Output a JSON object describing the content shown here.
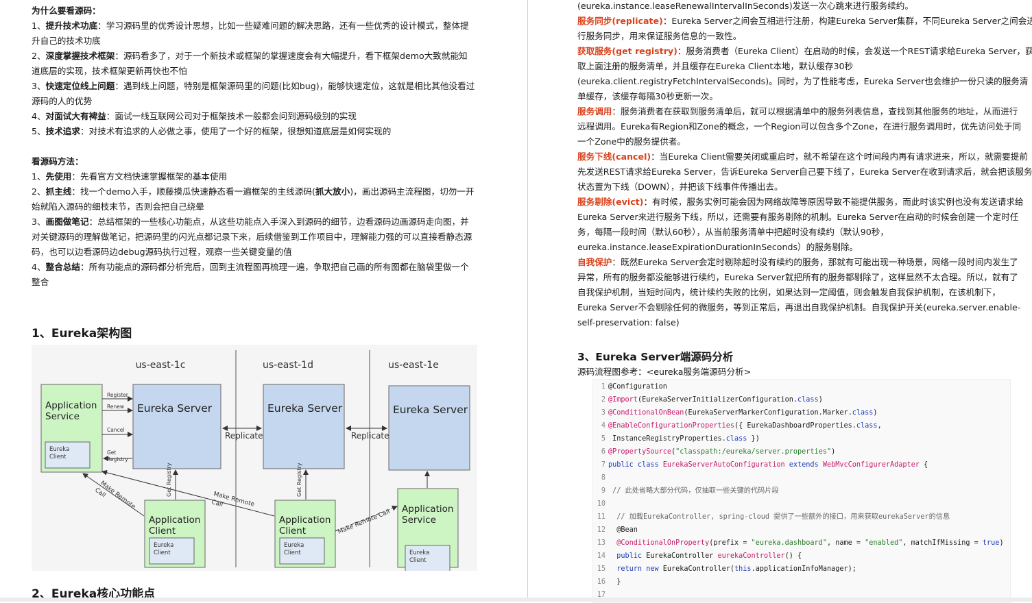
{
  "left": {
    "why_title": "为什么要看源码：",
    "why_items": [
      {
        "num": "1、",
        "key": "提升技术功底",
        "sep": "：",
        "text_line1": "学习源码里的优秀设计思想，比如一些疑难问题的解决思路，还有一些优秀的设计模式，整体提",
        "text_line2": "升自己的技术功底"
      },
      {
        "num": "2、",
        "key": "深度掌握技术框架",
        "sep": "：",
        "text_line1": "源码看多了，对于一个新技术或框架的掌握速度会有大幅提升，看下框架demo大致就能知",
        "text_line2": "道底层的实现，技术框架更新再快也不怕"
      },
      {
        "num": "3、",
        "key": "快速定位线上问题",
        "sep": "：",
        "text_line1": "遇到线上问题，特别是框架源码里的问题(比如bug)，能够快速定位，这就是相比其他没看过",
        "text_line2": "源码的人的优势"
      },
      {
        "num": "4、",
        "key": "对面试大有裨益",
        "sep": "：",
        "text_line1": "面试一线互联网公司对于框架技术一般都会问到源码级别的实现",
        "text_line2": ""
      },
      {
        "num": "5、",
        "key": "技术追求",
        "sep": "：",
        "text_line1": "对技术有追求的人必做之事，使用了一个好的框架，很想知道底层是如何实现的",
        "text_line2": ""
      }
    ],
    "method_title": "看源码方法：",
    "method_items": {
      "m1": {
        "num": "1、",
        "key": "先使用",
        "text": "：先看官方文档快速掌握框架的基本使用"
      },
      "m2": {
        "num": "2、",
        "key": "抓主线",
        "text_a": "：找一个demo入手，顺藤摸瓜快速静态看一遍框架的主线源码(",
        "bold_b": "抓大放小",
        "text_c": ")，画出源码主流程图，切勿一开",
        "line2": "始就陷入源码的细枝末节，否则会把自己绕晕"
      },
      "m3": {
        "num": "3、",
        "key": "画图做笔记",
        "text": "：总结框架的一些核心功能点，从这些功能点入手深入到源码的细节，边看源码边画源码走向图，并",
        "line2": "对关键源码的理解做笔记，把源码里的闪光点都记录下来，后续借鉴到工作项目中，理解能力强的可以直接看静态源",
        "line3": "码，也可以边看源码边debug源码执行过程，观察一些关键变量的值"
      },
      "m4": {
        "num": "4、",
        "key": "整合总结",
        "text": "：所有功能点的源码都分析完后，回到主流程图再梳理一遍，争取把自己画的所有图都在脑袋里做一个",
        "line2": "整合"
      }
    },
    "section1_title": "1、Eureka架构图",
    "section2_title": "2、Eureka核心功能点",
    "diagram": {
      "regions": [
        "us-east-1c",
        "us-east-1d",
        "us-east-1e"
      ],
      "server_label": "Eureka Server",
      "app_service_l1": "Application",
      "app_service_l2": "Service",
      "app_client_l1": "Application",
      "app_client_l2": "Client",
      "eureka_client_l1": "Eureka",
      "eureka_client_l2": "Client",
      "register": "Register",
      "renew": "Renew",
      "cancel": "Cancel",
      "get": "Get",
      "registry": "Registry",
      "replicate": "Replicate",
      "get_registry": "Get Registry",
      "make_remote_call": "Make Remote Call",
      "make_remote": "Make Remote",
      "call": "Call"
    }
  },
  "right": {
    "top_line": "(eureka.instance.leaseRenewalIntervalInSeconds)发送一次心跳来进行服务续约。",
    "sync": {
      "key": "服务同步(replicate)",
      "l1": "：Eureka Server之间会互相进行注册，构建Eureka Server集群，不同Eureka Server之间会进",
      "l2": "行服务同步，用来保证服务信息的一致性。"
    },
    "get": {
      "key": "获取服务(get registry)",
      "l1": "：服务消费者（Eureka Client）在启动的时候，会发送一个REST请求给Eureka Server，获",
      "l2": "取上面注册的服务清单，并且缓存在Eureka Client本地，默认缓存30秒",
      "l3": "(eureka.client.registryFetchIntervalSeconds)。同时，为了性能考虑，Eureka Server也会维护一份只读的服务清",
      "l4": "单缓存，该缓存每隔30秒更新一次。"
    },
    "call": {
      "key": "服务调用",
      "l1": "：服务消费者在获取到服务清单后，就可以根据清单中的服务列表信息，查找到其他服务的地址，从而进行",
      "l2": "远程调用。Eureka有Region和Zone的概念，一个Region可以包含多个Zone，在进行服务调用时，优先访问处于同",
      "l3": "一个Zone中的服务提供者。"
    },
    "cancel": {
      "key": "服务下线(cancel)",
      "l1": "：当Eureka Client需要关闭或重启时，就不希望在这个时间段内再有请求进来，所以，就需要提前",
      "l2": "先发送REST请求给Eureka Server，告诉Eureka Server自己要下线了，Eureka Server在收到请求后，就会把该服务",
      "l3": "状态置为下线（DOWN），并把该下线事件传播出去。"
    },
    "evict": {
      "key": "服务剔除(evict)",
      "l1": "：有时候，服务实例可能会因为网络故障等原因导致不能提供服务，而此时该实例也没有发送请求给",
      "l2": "Eureka Server来进行服务下线，所以，还需要有服务剔除的机制。Eureka Server在启动的时候会创建一个定时任",
      "l3": "务，每隔一段时间（默认60秒），从当前服务清单中把超时没有续约（默认90秒，",
      "l4": "eureka.instance.leaseExpirationDurationInSeconds）的服务剔除。"
    },
    "protect": {
      "key": "自我保护",
      "l1": "：既然Eureka Server会定时剔除超时没有续约的服务，那就有可能出现一种场景，网络一段时间内发生了",
      "l2": "异常，所有的服务都没能够进行续约，Eureka Server就把所有的服务都剔除了，这样显然不太合理。所以，就有了",
      "l3": "自我保护机制，当短时间内，统计续约失败的比例，如果达到一定阈值，则会触发自我保护机制，在该机制下，",
      "l4": "Eureka Server不会剔除任何的微服务，等到正常后，再退出自我保护机制。自我保护开关(eureka.server.enable-",
      "l5": "self-preservation: false)"
    },
    "section3_title": "3、Eureka Server端源码分析",
    "ref_text": "源码流程图参考：<eureka服务端源码分析>",
    "code": {
      "n": [
        "1",
        "2",
        "3",
        "4",
        "5",
        "6",
        "7",
        "8",
        "9",
        "10",
        "11",
        "12",
        "13",
        "14",
        "15",
        "16",
        "17"
      ],
      "l1": "@Configuration",
      "l2_an": "@Import",
      "l2_a": "(EurekaServerInitializerConfiguration.",
      "l2_kw": "class",
      "l2_b": ")",
      "l3_an": "@ConditionalOnBean",
      "l3_a": "(EurekaServerMarkerConfiguration.Marker.",
      "l3_kw": "class",
      "l3_b": ")",
      "l4_an": "@EnableConfigurationProperties",
      "l4_a": "({ EurekaDashboardProperties.",
      "l4_kw": "class",
      "l4_b": ",",
      "l5_a": " InstanceRegistryProperties.",
      "l5_kw": "class",
      "l5_b": " })",
      "l6_an": "@PropertySource",
      "l6_a": "(",
      "l6_st": "\"classpath:/eureka/server.properties\"",
      "l6_b": ")",
      "l7_kw1": "public class",
      "l7_an": "EurekaServerAutoConfiguration",
      "l7_kw2": "extends",
      "l7_an2": "WebMvcConfigurerAdapter",
      "l7_b": " {",
      "l9": " // 此处省略大部分代码，仅抽取一些关键的代码片段",
      "l11": "  // 加载EurekaController, spring-cloud 提供了一些额外的接口，用来获取eurekaServer的信息",
      "l12": "  @Bean",
      "l13_an": "  @ConditionalOnProperty",
      "l13_a": "(prefix = ",
      "l13_st": "\"eureka.dashboard\"",
      "l13_b": ", name = ",
      "l13_st2": "\"enabled\"",
      "l13_c": ", matchIfMissing = ",
      "l13_kw": "true",
      "l13_d": ")",
      "l14_kw": "  public",
      "l14_a": " EurekaController ",
      "l14_an": "eurekaController",
      "l14_b": "() {",
      "l15_kw": "  return new",
      "l15_a": " EurekaController(",
      "l15_kw2": "this",
      "l15_b": ".applicationInfoManager);",
      "l16": "  }"
    }
  }
}
